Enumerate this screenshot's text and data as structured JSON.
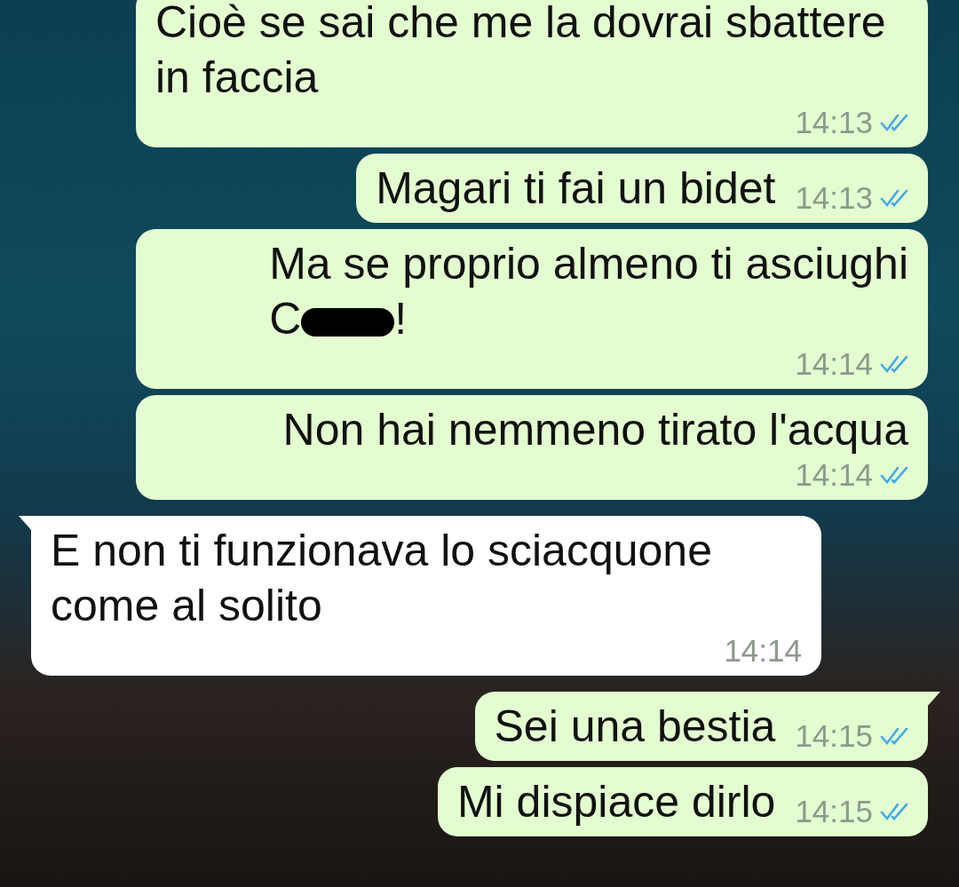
{
  "messages": [
    {
      "kind": "outgoing",
      "tail": false,
      "text": "Cioè se sai che me la dovrai sbattere in faccia",
      "time": "14:13",
      "read": true
    },
    {
      "kind": "outgoing",
      "tail": false,
      "text": "Magari ti fai un bidet",
      "time": "14:13",
      "read": true
    },
    {
      "kind": "outgoing",
      "tail": false,
      "text": "Ma se proprio almeno ti asciughi\nC",
      "redacted": true,
      "text_after": "!",
      "time": "14:14",
      "read": true
    },
    {
      "kind": "outgoing",
      "tail": false,
      "text": "Non hai nemmeno tirato l'acqua",
      "time": "14:14",
      "read": true
    },
    {
      "kind": "incoming",
      "tail": true,
      "text": "E non ti funzionava lo sciacquone come al solito",
      "time": "14:14"
    },
    {
      "kind": "outgoing",
      "tail": true,
      "text": "Sei una bestia",
      "time": "14:15",
      "read": true
    },
    {
      "kind": "outgoing",
      "tail": false,
      "text": "Mi dispiace dirlo",
      "time": "14:15",
      "read": true
    }
  ]
}
